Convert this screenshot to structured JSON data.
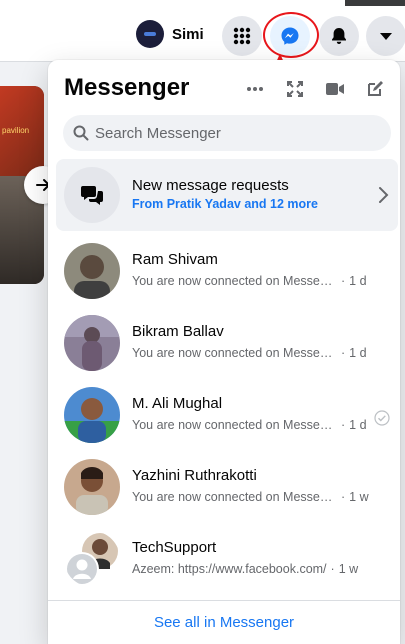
{
  "topbar": {
    "profile_name": "Simi",
    "buttons": [
      "menu-grid-icon",
      "messenger-icon",
      "notifications-bell-icon",
      "account-dropdown-icon"
    ]
  },
  "background": {
    "card_tag": "pavilion"
  },
  "messenger": {
    "title": "Messenger",
    "search_placeholder": "Search Messenger",
    "requests": {
      "title": "New message requests",
      "subtitle": "From Pratik Yadav and 12 more"
    },
    "conversations": [
      {
        "name": "Ram Shivam",
        "snippet": "You are now connected on Messenger",
        "time": "1 d",
        "avatar_color": "#6e6a5c"
      },
      {
        "name": "Bikram Ballav",
        "snippet": "You are now connected on Messenger",
        "time": "1 d",
        "avatar_color": "#7b6f8a"
      },
      {
        "name": "M. Ali Mughal",
        "snippet": "You are now connected on Messenger",
        "time": "1 d",
        "avatar_color": "#3c7fc4",
        "seen": true
      },
      {
        "name": "Yazhini Ruthrakotti",
        "snippet": "You are now connected on Messenger",
        "time": "1 w",
        "avatar_color": "#b98a6e"
      },
      {
        "name": "TechSupport",
        "snippet": "Azeem: https://www.facebook.com/",
        "time": "1 w",
        "avatar_color": "#3b3b3b"
      }
    ],
    "footer_link": "See all in Messenger"
  },
  "colors": {
    "accent": "#1877f2",
    "annotation": "#e8161b",
    "secondary_text": "#65676b"
  }
}
